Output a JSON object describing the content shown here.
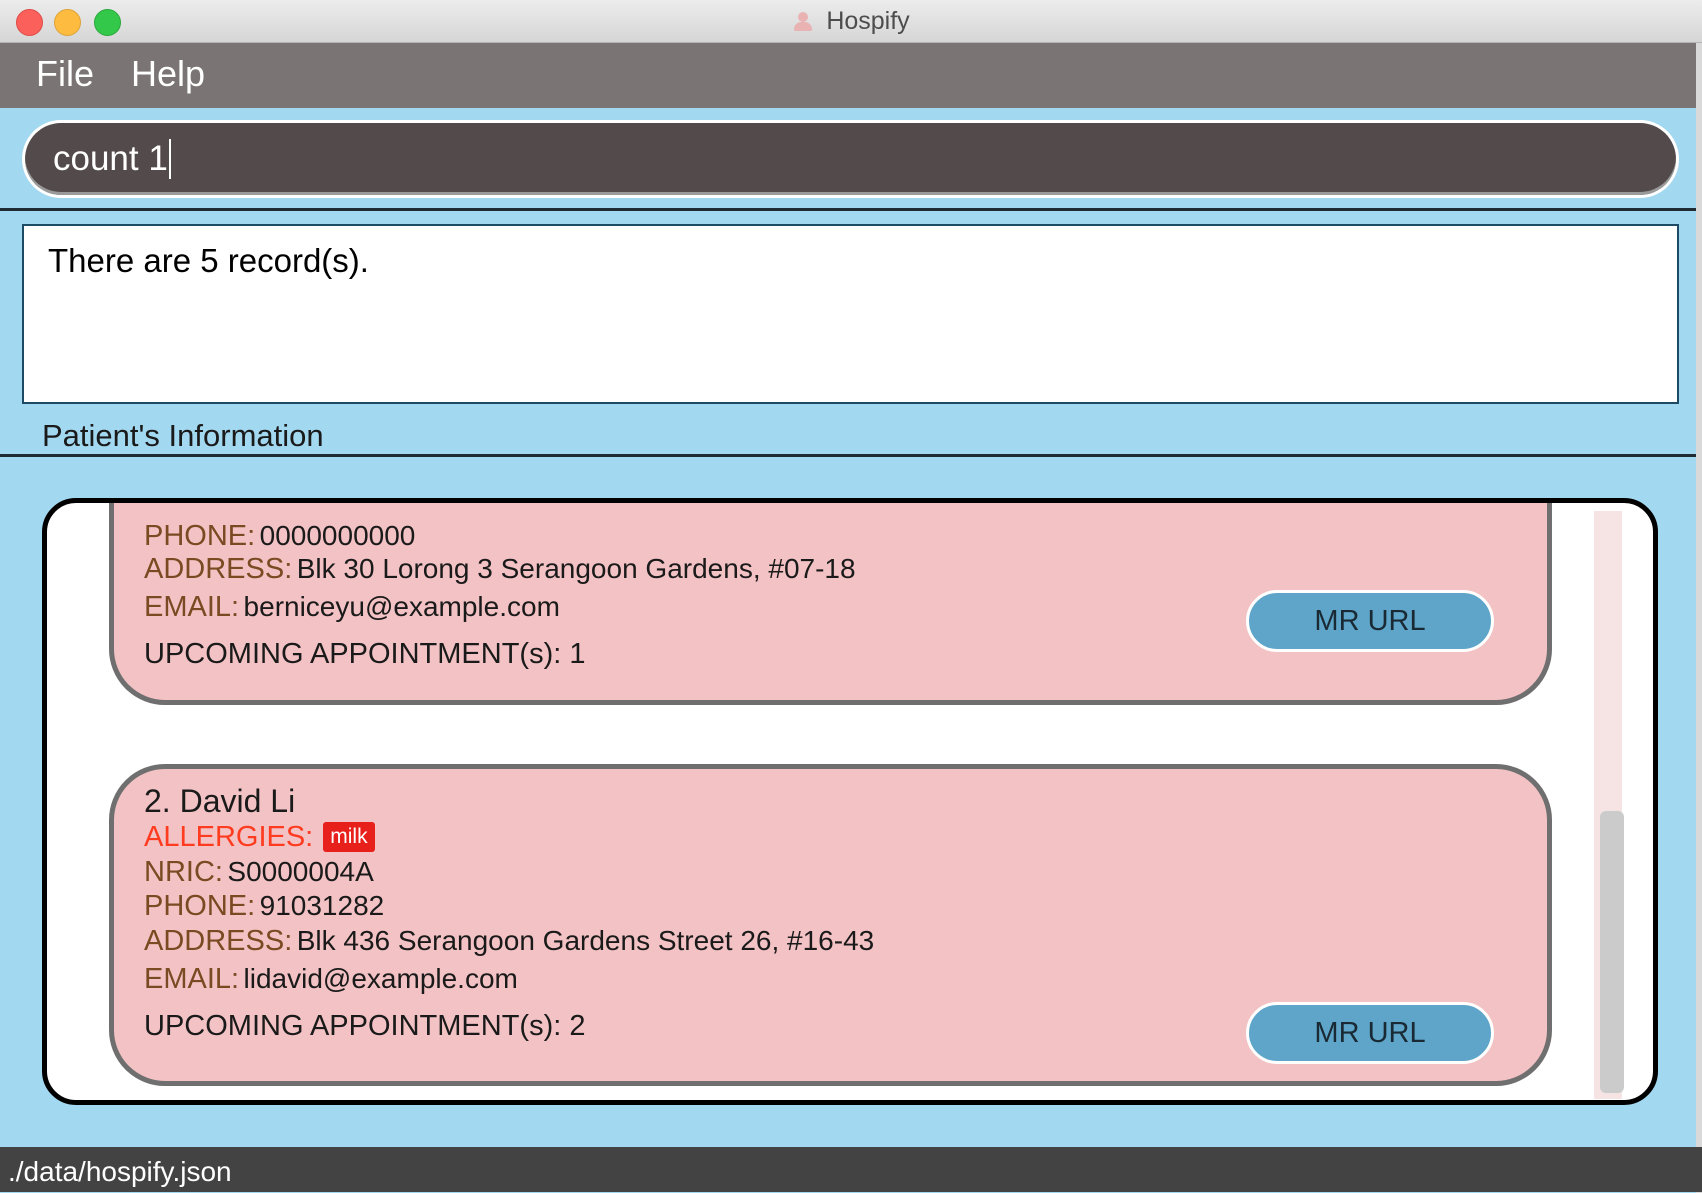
{
  "window": {
    "title": "Hospify",
    "app_icon": "patient-person-icon"
  },
  "menu": {
    "file": "File",
    "help": "Help"
  },
  "command": {
    "value": "count 1"
  },
  "result": {
    "message": "There are 5 record(s)."
  },
  "section": {
    "title": "Patient's Information"
  },
  "patients": [
    {
      "phone_label": "PHONE:",
      "phone": "0000000000",
      "address_label": "ADDRESS:",
      "address": "Blk 30 Lorong 3 Serangoon Gardens, #07-18",
      "email_label": "EMAIL:",
      "email": "berniceyu@example.com",
      "appointments": "UPCOMING APPOINTMENT(s): 1",
      "mr_button": "MR URL"
    },
    {
      "index_name": "2.  David Li",
      "allergies_label": "ALLERGIES:",
      "allergy_tag": "milk",
      "nric_label": "NRIC:",
      "nric": "S0000004A",
      "phone_label": "PHONE:",
      "phone": "91031282",
      "address_label": "ADDRESS:",
      "address": "Blk 436 Serangoon Gardens Street 26, #16-43",
      "email_label": "EMAIL:",
      "email": "lidavid@example.com",
      "appointments": "UPCOMING APPOINTMENT(s): 2",
      "mr_button": "MR URL"
    }
  ],
  "status": {
    "file_path": "./data/hospify.json"
  },
  "colors": {
    "background": "#a3d8f1",
    "menubar": "#7a7474",
    "command_box": "#534b4b",
    "card": "#f3c2c4",
    "field_label": "#7a4a22",
    "allergy": "#ff3b20",
    "button": "#5ea5c9",
    "statusbar": "#434343"
  }
}
